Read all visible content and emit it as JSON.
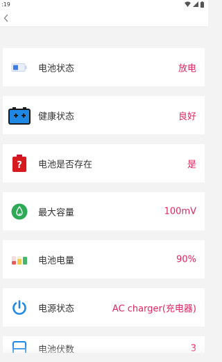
{
  "status_bar": {
    "time": ":19",
    "icons": [
      "wifi-icon",
      "signal-icon",
      "battery-icon"
    ]
  },
  "app_bar": {
    "back_icon": "chevron-left-icon"
  },
  "colors": {
    "value_text": "#e0245e",
    "label_text": "#333333",
    "background": "#f3f3f3",
    "card": "#ffffff"
  },
  "rows": [
    {
      "label": "电池状态",
      "value": "放电",
      "icon": "battery-status-icon"
    },
    {
      "label": "健康状态",
      "value": "良好",
      "icon": "battery-health-icon"
    },
    {
      "label": "电池是否存在",
      "value": "是",
      "icon": "battery-present-icon"
    },
    {
      "label": "最大容量",
      "value": "100mV",
      "icon": "capacity-icon"
    },
    {
      "label": "电池电量",
      "value": "90%",
      "icon": "battery-level-icon"
    },
    {
      "label": "电源状态",
      "value": "AC charger(充电器)",
      "icon": "power-icon"
    },
    {
      "label": "电池伏数",
      "value": "3",
      "icon": "voltage-icon"
    }
  ]
}
